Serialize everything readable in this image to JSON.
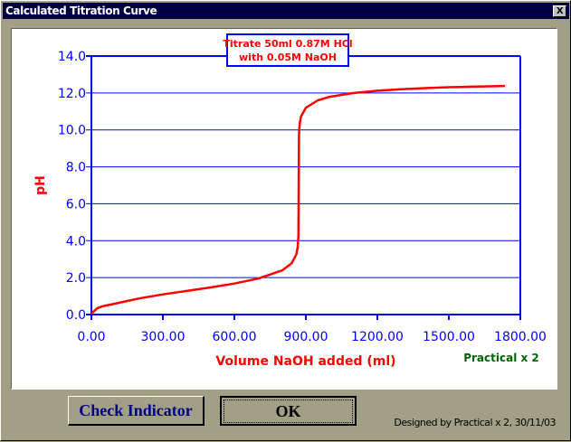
{
  "window": {
    "title": "Calculated Titration Curve",
    "close_label": "X"
  },
  "buttons": {
    "check_indicator": "Check Indicator",
    "ok": "OK"
  },
  "credit": "Designed by Practical x 2, 30/11/03",
  "watermark": "Practical x 2",
  "colors": {
    "axis": "#0000ff",
    "curve": "#ff0000",
    "label": "#ff0000",
    "watermark": "#006400"
  },
  "chart_data": {
    "type": "line",
    "title_lines": [
      "Titrate 50ml 0.87M HCl",
      "with 0.05M NaOH"
    ],
    "xlabel": "Volume NaOH added (ml)",
    "ylabel": "pH",
    "xlim": [
      0,
      1800
    ],
    "ylim": [
      0,
      14
    ],
    "xticks": [
      "0.00",
      "300.00",
      "600.00",
      "900.00",
      "1200.00",
      "1500.00",
      "1800.00"
    ],
    "yticks": [
      "0.0",
      "2.0",
      "4.0",
      "6.0",
      "8.0",
      "10.0",
      "12.0",
      "14.0"
    ],
    "grid": "horizontal",
    "series": [
      {
        "name": "pH",
        "x": [
          0,
          25,
          50,
          100,
          200,
          300,
          400,
          500,
          600,
          700,
          800,
          840,
          860,
          866,
          869,
          870,
          871,
          874,
          880,
          900,
          950,
          1000,
          1100,
          1200,
          1300,
          1400,
          1500,
          1600,
          1735
        ],
        "y": [
          0.06,
          0.35,
          0.46,
          0.59,
          0.87,
          1.09,
          1.28,
          1.47,
          1.68,
          1.95,
          2.39,
          2.77,
          3.26,
          3.66,
          4.26,
          7.0,
          9.73,
          10.34,
          10.73,
          11.2,
          11.6,
          11.79,
          12.0,
          12.12,
          12.2,
          12.26,
          12.31,
          12.34,
          12.38
        ]
      }
    ]
  }
}
